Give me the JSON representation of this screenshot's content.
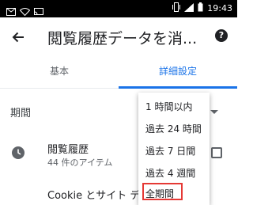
{
  "status_bar": {
    "time": "19:43",
    "left_icons": [
      "mail-icon",
      "wifi-icon",
      "cast-icon"
    ],
    "right_icons": [
      "vibrate-icon",
      "signal-icon",
      "battery-icon"
    ]
  },
  "app_bar": {
    "title": "閲覧履歴データを消...",
    "help_label": "?"
  },
  "tabs": [
    {
      "label": "基本",
      "selected": false
    },
    {
      "label": "詳細設定",
      "selected": true
    }
  ],
  "period": {
    "label": "期間"
  },
  "dropdown": {
    "options": [
      "1 時間以内",
      "過去 24 時間",
      "過去 7 日間",
      "過去 4 週間",
      "全期間"
    ],
    "highlighted_option": "全期間"
  },
  "history": {
    "title": "閲覧履歴",
    "subtitle": "44 件のアイテム"
  },
  "cookies": {
    "title": "Cookie とサイト デー"
  },
  "colors": {
    "accent": "#1a73e8",
    "highlight": "#e53935",
    "status_bar": "#000000"
  }
}
